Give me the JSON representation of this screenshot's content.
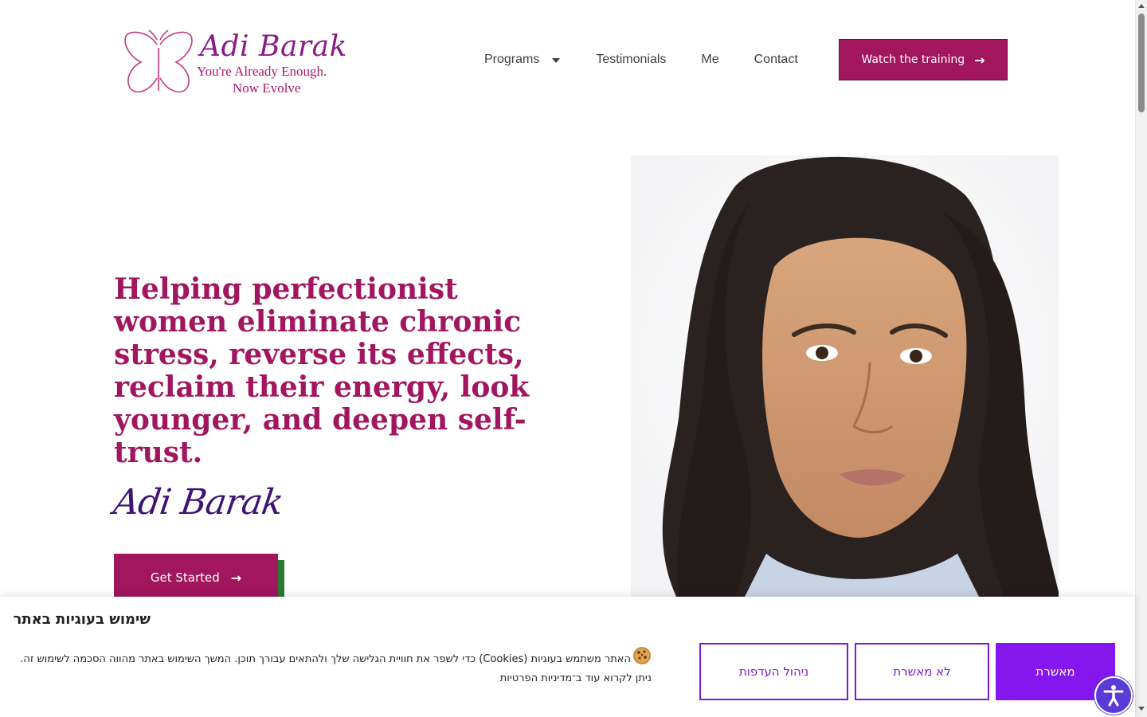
{
  "brand": {
    "name": "Adi Barak",
    "tagline_line1": "You're Already Enough.",
    "tagline_line2": "Now Evolve",
    "icon": "butterfly-icon"
  },
  "nav": {
    "items": [
      {
        "label": "Programs",
        "has_dropdown": true
      },
      {
        "label": "Testimonials"
      },
      {
        "label": "Me"
      },
      {
        "label": "Contact"
      }
    ],
    "cta_label": "Watch the training"
  },
  "hero": {
    "headline": "Helping perfectionist women eliminate chronic stress, reverse its effects, reclaim their energy, look younger, and deepen self-trust.",
    "signature": "Adi Barak",
    "cta_label": "Get Started",
    "portrait": "portrait-photo"
  },
  "cookie_banner": {
    "title": "שימוש בעוגיות באתר",
    "text_line1": "האתר משתמש בעוגיות (Cookies) כדי לשפר את חוויית הגלישה שלך ולהתאים עבורך תוכן. המשך השימוש באתר מהווה הסכמה לשימוש זה.",
    "text_line2": "ניתן לקרוא עוד ב־מדיניות הפרטיות",
    "buttons": {
      "manage": "ניהול העדפות",
      "reject": "לא מאשרת",
      "accept": "מאשרת"
    },
    "icon": "cookie-icon"
  },
  "accessibility": {
    "icon": "accessibility-icon"
  },
  "colors": {
    "brand_magenta": "#a2155f",
    "signature_purple": "#3d1474",
    "cookie_purple": "#8416ee",
    "accessibility_blue": "#5b3bd8"
  }
}
